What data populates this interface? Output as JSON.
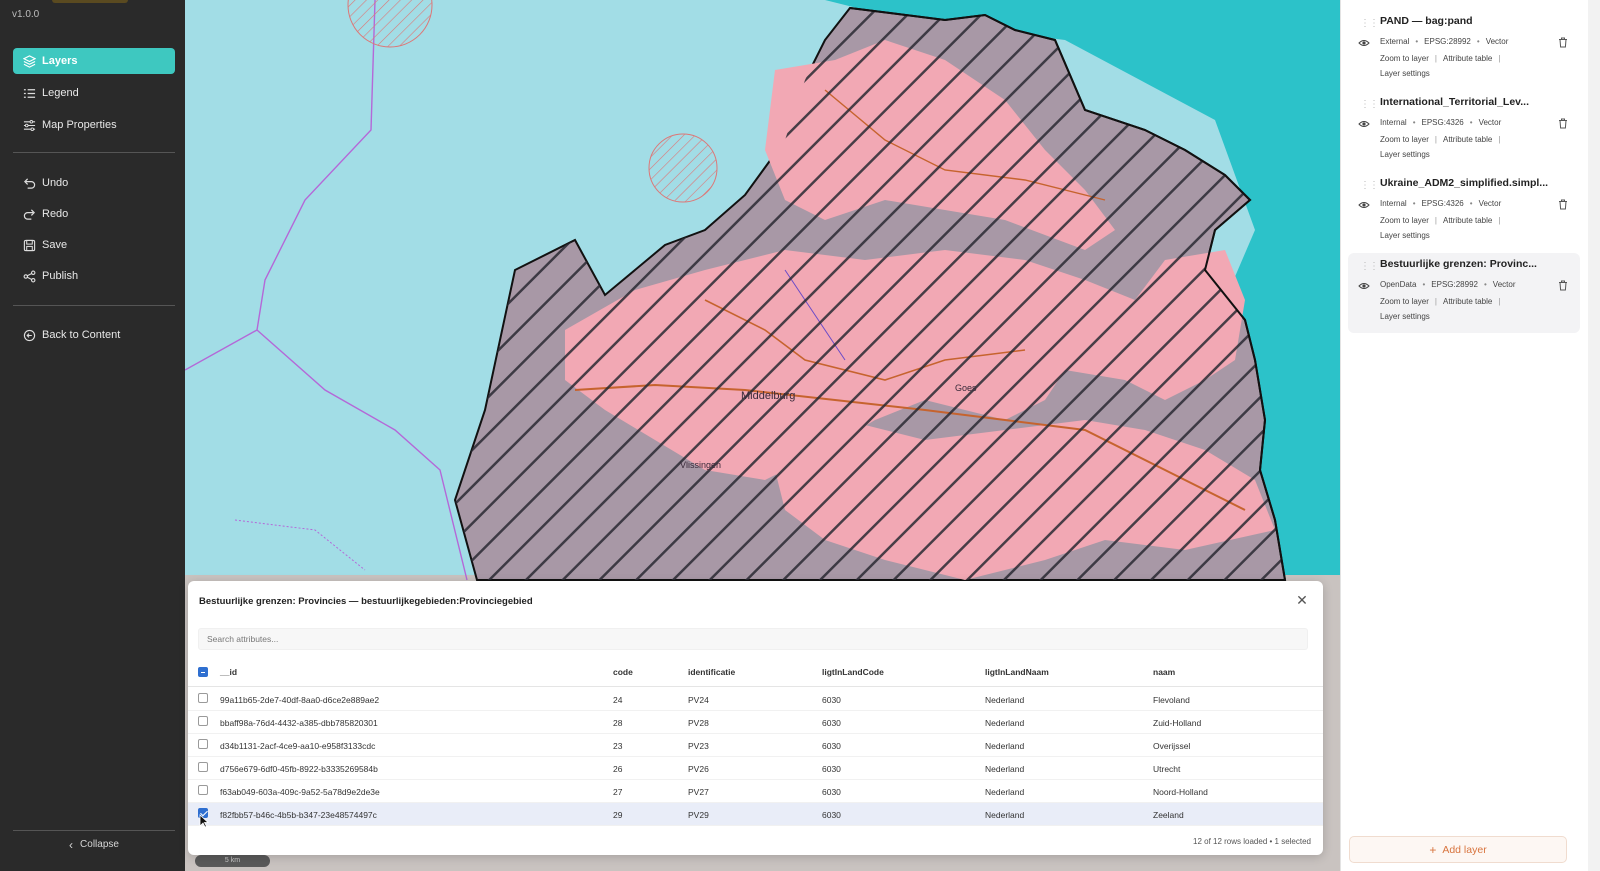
{
  "app": {
    "version": "v1.0.0"
  },
  "sidebar": {
    "items": [
      {
        "label": "Layers",
        "icon": "layers-icon",
        "active": true
      },
      {
        "label": "Legend",
        "icon": "list-icon",
        "active": false
      },
      {
        "label": "Map Properties",
        "icon": "sliders-icon",
        "active": false
      }
    ],
    "actions": [
      {
        "label": "Undo",
        "icon": "undo-icon"
      },
      {
        "label": "Redo",
        "icon": "redo-icon"
      },
      {
        "label": "Save",
        "icon": "save-icon"
      },
      {
        "label": "Publish",
        "icon": "share-icon"
      }
    ],
    "back_label": "Back to Content",
    "collapse_label": "Collapse",
    "accent_color": "#3ec8c0"
  },
  "map": {
    "place_labels": [
      "Middelburg",
      "Vlissingen",
      "Goes"
    ],
    "scale_label": "5 km"
  },
  "layers": [
    {
      "title": "PAND — bag:pand",
      "source": "External",
      "crs": "EPSG:28992",
      "type": "Vector",
      "zoom_label": "Zoom to layer",
      "table_label": "Attribute table",
      "settings_label": "Layer settings",
      "selected": false
    },
    {
      "title": "International_Territorial_Lev...",
      "source": "Internal",
      "crs": "EPSG:4326",
      "type": "Vector",
      "zoom_label": "Zoom to layer",
      "table_label": "Attribute table",
      "settings_label": "Layer settings",
      "selected": false
    },
    {
      "title": "Ukraine_ADM2_simplified.simpl...",
      "source": "Internal",
      "crs": "EPSG:4326",
      "type": "Vector",
      "zoom_label": "Zoom to layer",
      "table_label": "Attribute table",
      "settings_label": "Layer settings",
      "selected": false
    },
    {
      "title": "Bestuurlijke grenzen: Provinc...",
      "source": "OpenData",
      "crs": "EPSG:28992",
      "type": "Vector",
      "zoom_label": "Zoom to layer",
      "table_label": "Attribute table",
      "settings_label": "Layer settings",
      "selected": true
    }
  ],
  "add_layer_label": "Add layer",
  "attribute_table": {
    "title": "Bestuurlijke grenzen: Provincies — bestuurlijkegebieden:Provinciegebied",
    "search_placeholder": "Search attributes...",
    "columns": [
      "__id",
      "code",
      "identificatie",
      "ligtInLandCode",
      "ligtInLandNaam",
      "naam"
    ],
    "rows": [
      {
        "id": "99a11b65-2de7-40df-8aa0-d6ce2e889ae2",
        "code": "24",
        "identificatie": "PV24",
        "landcode": "6030",
        "landnaam": "Nederland",
        "naam": "Flevoland",
        "checked": false
      },
      {
        "id": "bbaff98a-76d4-4432-a385-dbb785820301",
        "code": "28",
        "identificatie": "PV28",
        "landcode": "6030",
        "landnaam": "Nederland",
        "naam": "Zuid-Holland",
        "checked": false
      },
      {
        "id": "d34b1131-2acf-4ce9-aa10-e958f3133cdc",
        "code": "23",
        "identificatie": "PV23",
        "landcode": "6030",
        "landnaam": "Nederland",
        "naam": "Overijssel",
        "checked": false
      },
      {
        "id": "d756e679-6df0-45fb-8922-b3335269584b",
        "code": "26",
        "identificatie": "PV26",
        "landcode": "6030",
        "landnaam": "Nederland",
        "naam": "Utrecht",
        "checked": false
      },
      {
        "id": "f63ab049-603a-409c-9a52-5a78d9e2de3e",
        "code": "27",
        "identificatie": "PV27",
        "landcode": "6030",
        "landnaam": "Nederland",
        "naam": "Noord-Holland",
        "checked": false
      },
      {
        "id": "f82fbb57-b46c-4b5b-b347-23e48574497c",
        "code": "29",
        "identificatie": "PV29",
        "landcode": "6030",
        "landnaam": "Nederland",
        "naam": "Zeeland",
        "checked": true
      }
    ],
    "status": "12 of 12 rows loaded • 1 selected"
  }
}
